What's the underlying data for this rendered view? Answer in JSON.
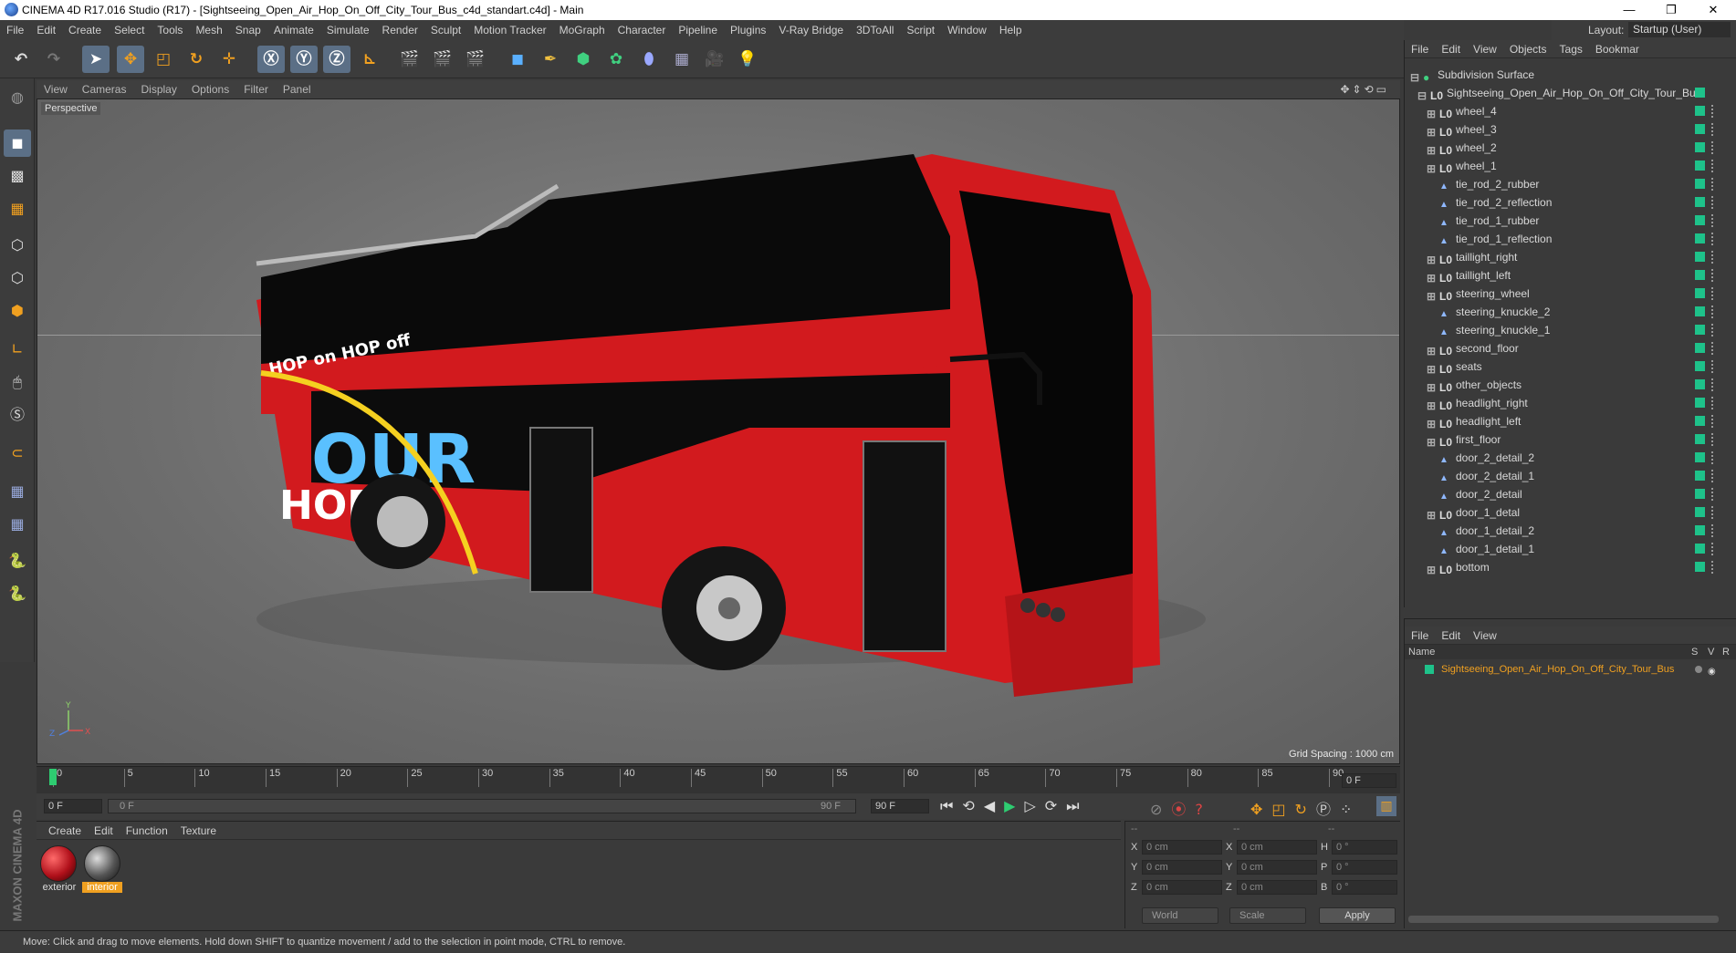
{
  "window": {
    "title": "CINEMA 4D R17.016 Studio (R17) - [Sightseeing_Open_Air_Hop_On_Off_City_Tour_Bus_c4d_standart.c4d] - Main",
    "controls": {
      "minimize": "—",
      "restore": "❐",
      "close": "✕"
    }
  },
  "menubar": [
    "File",
    "Edit",
    "Create",
    "Select",
    "Tools",
    "Mesh",
    "Snap",
    "Animate",
    "Simulate",
    "Render",
    "Sculpt",
    "Motion Tracker",
    "MoGraph",
    "Character",
    "Pipeline",
    "Plugins",
    "V-Ray Bridge",
    "3DToAll",
    "Script",
    "Window",
    "Help"
  ],
  "layout": {
    "label": "Layout:",
    "value": "Startup (User)"
  },
  "viewport": {
    "menu": [
      "View",
      "Cameras",
      "Display",
      "Options",
      "Filter",
      "Panel"
    ],
    "label": "Perspective",
    "grid_spacing": "Grid Spacing : 1000 cm"
  },
  "object_manager": {
    "menu": [
      "File",
      "Edit",
      "View",
      "Objects",
      "Tags",
      "Bookmar"
    ],
    "root": "Subdivision Surface",
    "group": "Sightseeing_Open_Air_Hop_On_Off_City_Tour_Bus",
    "items": [
      {
        "name": "wheel_4",
        "type": "null"
      },
      {
        "name": "wheel_3",
        "type": "null"
      },
      {
        "name": "wheel_2",
        "type": "null"
      },
      {
        "name": "wheel_1",
        "type": "null"
      },
      {
        "name": "tie_rod_2_rubber",
        "type": "poly"
      },
      {
        "name": "tie_rod_2_reflection",
        "type": "poly"
      },
      {
        "name": "tie_rod_1_rubber",
        "type": "poly"
      },
      {
        "name": "tie_rod_1_reflection",
        "type": "poly"
      },
      {
        "name": "taillight_right",
        "type": "null"
      },
      {
        "name": "taillight_left",
        "type": "null"
      },
      {
        "name": "steering_wheel",
        "type": "null"
      },
      {
        "name": "steering_knuckle_2",
        "type": "poly"
      },
      {
        "name": "steering_knuckle_1",
        "type": "poly"
      },
      {
        "name": "second_floor",
        "type": "null"
      },
      {
        "name": "seats",
        "type": "null"
      },
      {
        "name": "other_objects",
        "type": "null"
      },
      {
        "name": "headlight_right",
        "type": "null"
      },
      {
        "name": "headlight_left",
        "type": "null"
      },
      {
        "name": "first_floor",
        "type": "null"
      },
      {
        "name": "door_2_detail_2",
        "type": "poly"
      },
      {
        "name": "door_2_detail_1",
        "type": "poly"
      },
      {
        "name": "door_2_detail",
        "type": "poly"
      },
      {
        "name": "door_1_detal",
        "type": "null"
      },
      {
        "name": "door_1_detail_2",
        "type": "poly"
      },
      {
        "name": "door_1_detail_1",
        "type": "poly"
      },
      {
        "name": "bottom",
        "type": "null"
      }
    ]
  },
  "layer_manager": {
    "menu": [
      "File",
      "Edit",
      "View"
    ],
    "header": {
      "name": "Name",
      "s": "S",
      "v": "V",
      "r": "R"
    },
    "layer": "Sightseeing_Open_Air_Hop_On_Off_City_Tour_Bus"
  },
  "timeline": {
    "ticks": [
      "0",
      "5",
      "10",
      "15",
      "20",
      "25",
      "30",
      "35",
      "40",
      "45",
      "50",
      "55",
      "60",
      "65",
      "70",
      "75",
      "80",
      "85",
      "90"
    ],
    "current_frame": "0 F"
  },
  "transport": {
    "start": "0 F",
    "range_start": "0 F",
    "range_end": "90 F",
    "end": "90 F"
  },
  "material_manager": {
    "menu": [
      "Create",
      "Edit",
      "Function",
      "Texture"
    ],
    "materials": [
      {
        "name": "exterior"
      },
      {
        "name": "interior"
      }
    ]
  },
  "coordinates": {
    "header_left": "--",
    "header_mid": "--",
    "header_right": "--",
    "rows": [
      {
        "axis": "X",
        "pos": "0 cm",
        "size_axis": "X",
        "size": "0 cm",
        "rot_axis": "H",
        "rot": "0 °"
      },
      {
        "axis": "Y",
        "pos": "0 cm",
        "size_axis": "Y",
        "size": "0 cm",
        "rot_axis": "P",
        "rot": "0 °"
      },
      {
        "axis": "Z",
        "pos": "0 cm",
        "size_axis": "Z",
        "size": "0 cm",
        "rot_axis": "B",
        "rot": "0 °"
      }
    ],
    "mode": "World",
    "scale": "Scale",
    "apply": "Apply"
  },
  "brand": "MAXON CINEMA 4D",
  "status": "Move: Click and drag to move elements. Hold down SHIFT to quantize movement / add to the selection in point mode, CTRL to remove.",
  "colors": {
    "bus_red": "#d6181c",
    "enabled_check": "#1ec28a",
    "highlight_orange": "#f0a020"
  }
}
